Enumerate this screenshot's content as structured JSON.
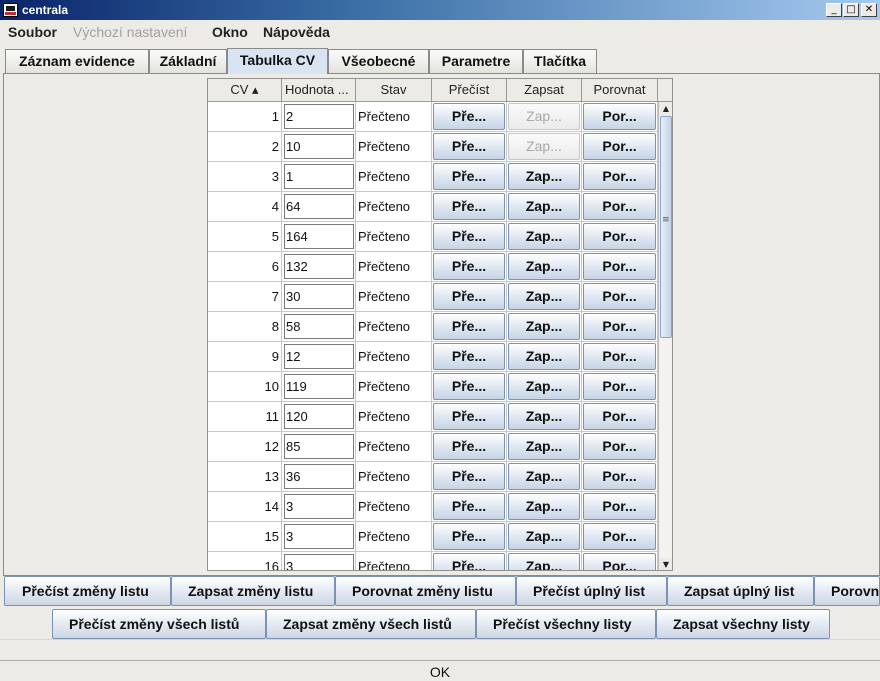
{
  "window": {
    "title": "centrala",
    "min": "_",
    "max": "□",
    "close": "✕"
  },
  "menu": {
    "items": [
      {
        "label": "Soubor",
        "enabled": true
      },
      {
        "label": "Výchozí nastavení",
        "enabled": false
      },
      {
        "label": "Okno",
        "enabled": true
      },
      {
        "label": "Nápověda",
        "enabled": true
      }
    ]
  },
  "tabs": [
    {
      "label": "Záznam evidence"
    },
    {
      "label": "Základní"
    },
    {
      "label": "Tabulka CV",
      "active": true
    },
    {
      "label": "Všeobecné"
    },
    {
      "label": "Parametre"
    },
    {
      "label": "Tlačítka"
    }
  ],
  "table": {
    "headers": {
      "cv": "CV ▴",
      "value": "Hodnota ...",
      "state": "Stav",
      "read": "Přečíst",
      "write": "Zapsat",
      "compare": "Porovnat"
    },
    "button_labels": {
      "read": "Pře...",
      "write": "Zap...",
      "compare": "Por..."
    },
    "rows": [
      {
        "cv": "1",
        "value": "2",
        "state": "Přečteno",
        "write_enabled": false
      },
      {
        "cv": "2",
        "value": "10",
        "state": "Přečteno",
        "write_enabled": false
      },
      {
        "cv": "3",
        "value": "1",
        "state": "Přečteno",
        "write_enabled": true
      },
      {
        "cv": "4",
        "value": "64",
        "state": "Přečteno",
        "write_enabled": true
      },
      {
        "cv": "5",
        "value": "164",
        "state": "Přečteno",
        "write_enabled": true
      },
      {
        "cv": "6",
        "value": "132",
        "state": "Přečteno",
        "write_enabled": true
      },
      {
        "cv": "7",
        "value": "30",
        "state": "Přečteno",
        "write_enabled": true
      },
      {
        "cv": "8",
        "value": "58",
        "state": "Přečteno",
        "write_enabled": true
      },
      {
        "cv": "9",
        "value": "12",
        "state": "Přečteno",
        "write_enabled": true
      },
      {
        "cv": "10",
        "value": "119",
        "state": "Přečteno",
        "write_enabled": true
      },
      {
        "cv": "11",
        "value": "120",
        "state": "Přečteno",
        "write_enabled": true
      },
      {
        "cv": "12",
        "value": "85",
        "state": "Přečteno",
        "write_enabled": true
      },
      {
        "cv": "13",
        "value": "36",
        "state": "Přečteno",
        "write_enabled": true
      },
      {
        "cv": "14",
        "value": "3",
        "state": "Přečteno",
        "write_enabled": true
      },
      {
        "cv": "15",
        "value": "3",
        "state": "Přečteno",
        "write_enabled": true
      },
      {
        "cv": "16",
        "value": "3",
        "state": "Přečteno",
        "write_enabled": true
      }
    ]
  },
  "sheet_buttons": [
    {
      "label": "Přečíst změny listu"
    },
    {
      "label": "Zapsat změny listu"
    },
    {
      "label": "Porovnat změny listu"
    },
    {
      "label": "Přečíst úplný list"
    },
    {
      "label": "Zapsat úplný list"
    },
    {
      "label": "Porovnat úplný list"
    }
  ],
  "all_sheets_buttons": [
    {
      "label": "Přečíst změny všech listů"
    },
    {
      "label": "Zapsat změny všech listů"
    },
    {
      "label": "Přečíst všechny listy"
    },
    {
      "label": "Zapsat všechny listy"
    }
  ],
  "ok_label": "OK"
}
